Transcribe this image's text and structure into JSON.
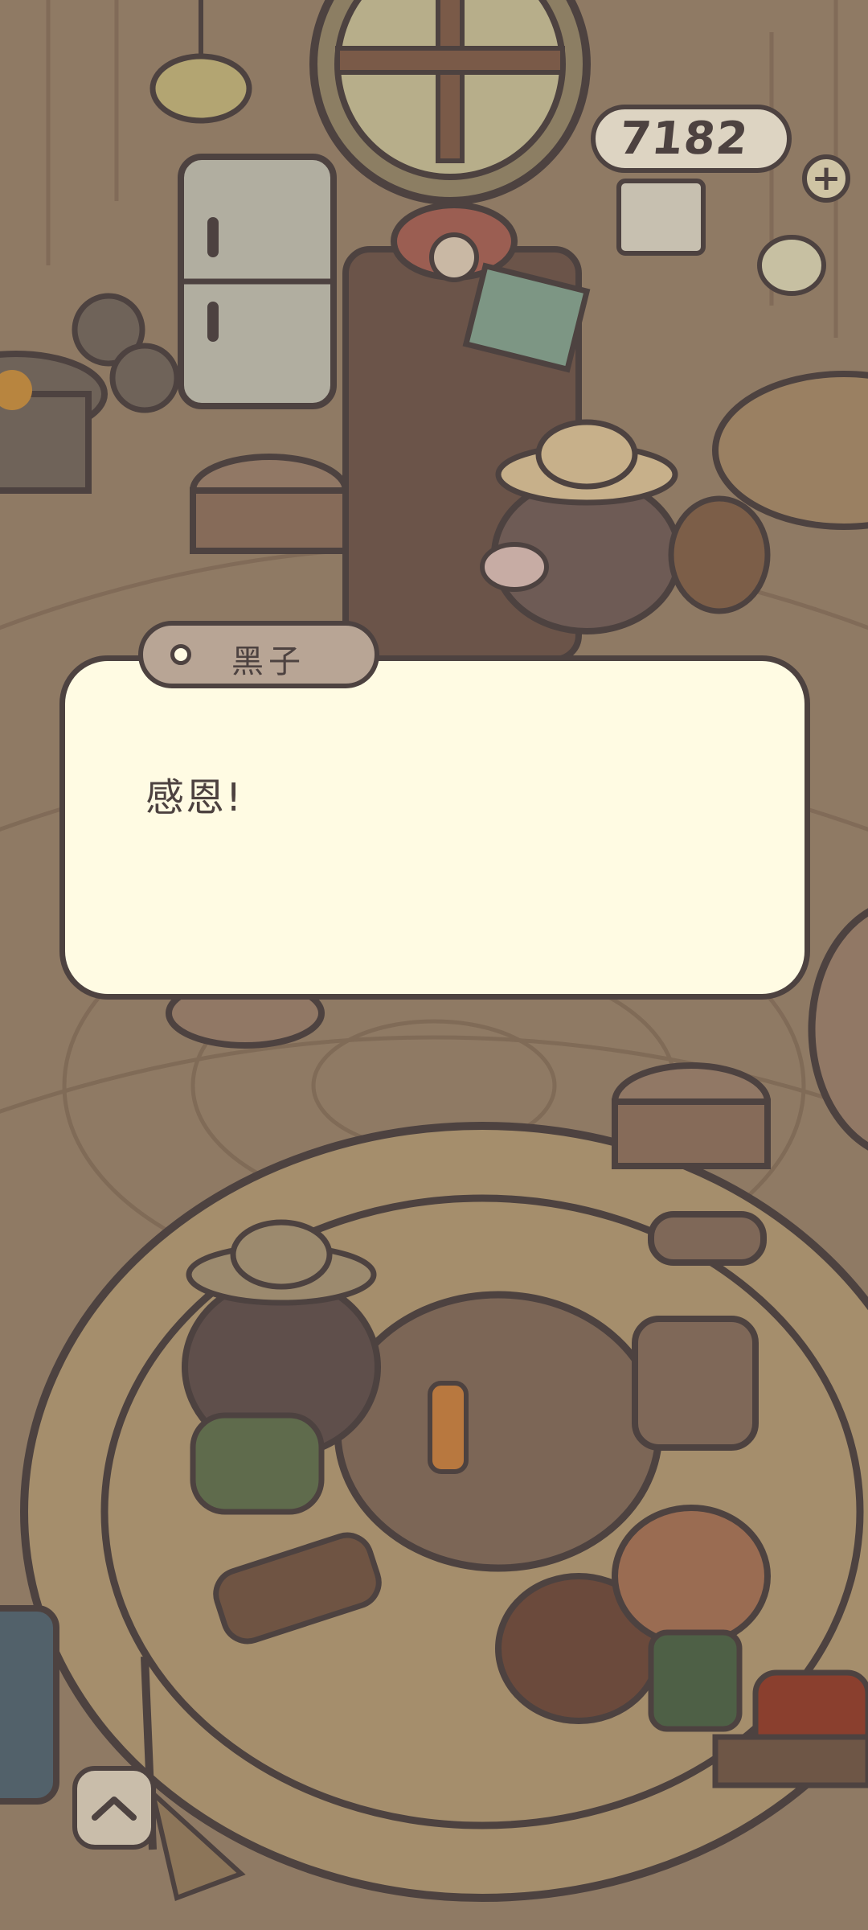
{
  "hud": {
    "coins": "7182",
    "add_coins_label": "+"
  },
  "dialog": {
    "speaker": "黑子",
    "text": "感恩!"
  },
  "icons": {
    "up_button": "chevron-up-icon",
    "coin_add": "plus-icon"
  },
  "colors": {
    "outline": "#4d4240",
    "dialog_background": "#fffbe3",
    "speaker_tab": "#b8a595",
    "scene_tint": "#8f7a64"
  }
}
